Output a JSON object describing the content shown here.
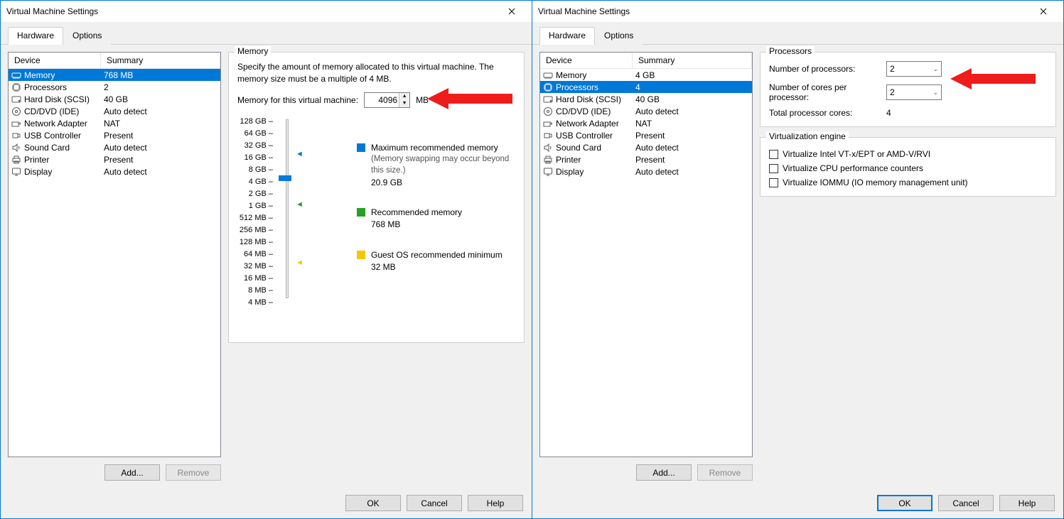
{
  "titles": {
    "left": "Virtual Machine Settings",
    "right": "Virtual Machine Settings"
  },
  "tabs": {
    "hardware": "Hardware",
    "options": "Options"
  },
  "headers": {
    "device": "Device",
    "summary": "Summary"
  },
  "devices_left": [
    {
      "k": "memory",
      "name": "Memory",
      "summary": "768 MB",
      "sel": true
    },
    {
      "k": "processors",
      "name": "Processors",
      "summary": "2"
    },
    {
      "k": "hard-disk",
      "name": "Hard Disk (SCSI)",
      "summary": "40 GB"
    },
    {
      "k": "cd-dvd",
      "name": "CD/DVD (IDE)",
      "summary": "Auto detect"
    },
    {
      "k": "net",
      "name": "Network Adapter",
      "summary": "NAT"
    },
    {
      "k": "usb",
      "name": "USB Controller",
      "summary": "Present"
    },
    {
      "k": "sound",
      "name": "Sound Card",
      "summary": "Auto detect"
    },
    {
      "k": "printer",
      "name": "Printer",
      "summary": "Present"
    },
    {
      "k": "display",
      "name": "Display",
      "summary": "Auto detect"
    }
  ],
  "devices_right": [
    {
      "k": "memory",
      "name": "Memory",
      "summary": "4 GB"
    },
    {
      "k": "processors",
      "name": "Processors",
      "summary": "4",
      "sel": true
    },
    {
      "k": "hard-disk",
      "name": "Hard Disk (SCSI)",
      "summary": "40 GB"
    },
    {
      "k": "cd-dvd",
      "name": "CD/DVD (IDE)",
      "summary": "Auto detect"
    },
    {
      "k": "net",
      "name": "Network Adapter",
      "summary": "NAT"
    },
    {
      "k": "usb",
      "name": "USB Controller",
      "summary": "Present"
    },
    {
      "k": "sound",
      "name": "Sound Card",
      "summary": "Auto detect"
    },
    {
      "k": "printer",
      "name": "Printer",
      "summary": "Present"
    },
    {
      "k": "display",
      "name": "Display",
      "summary": "Auto detect"
    }
  ],
  "buttons": {
    "add": "Add...",
    "remove": "Remove",
    "ok": "OK",
    "cancel": "Cancel",
    "help": "Help"
  },
  "memory": {
    "group": "Memory",
    "desc": "Specify the amount of memory allocated to this virtual machine. The memory size must be a multiple of 4 MB.",
    "field_label": "Memory for this virtual machine:",
    "value": "4096",
    "unit": "MB",
    "ticks": [
      "128 GB",
      "64 GB",
      "32 GB",
      "16 GB",
      "8 GB",
      "4 GB",
      "2 GB",
      "1 GB",
      "512 MB",
      "256 MB",
      "128 MB",
      "64 MB",
      "32 MB",
      "16 MB",
      "8 MB",
      "4 MB"
    ],
    "legend": {
      "max_label": "Maximum recommended memory",
      "max_note": "(Memory swapping may occur beyond this size.)",
      "max_value": "20.9 GB",
      "rec_label": "Recommended memory",
      "rec_value": "768 MB",
      "min_label": "Guest OS recommended minimum",
      "min_value": "32 MB"
    }
  },
  "processors": {
    "group": "Processors",
    "num_label": "Number of processors:",
    "num_value": "2",
    "cores_label": "Number of cores per processor:",
    "cores_value": "2",
    "total_label": "Total processor cores:",
    "total_value": "4"
  },
  "virt": {
    "group": "Virtualization engine",
    "vt": "Virtualize Intel VT-x/EPT or AMD-V/RVI",
    "perf": "Virtualize CPU performance counters",
    "iommu": "Virtualize IOMMU (IO memory management unit)"
  }
}
